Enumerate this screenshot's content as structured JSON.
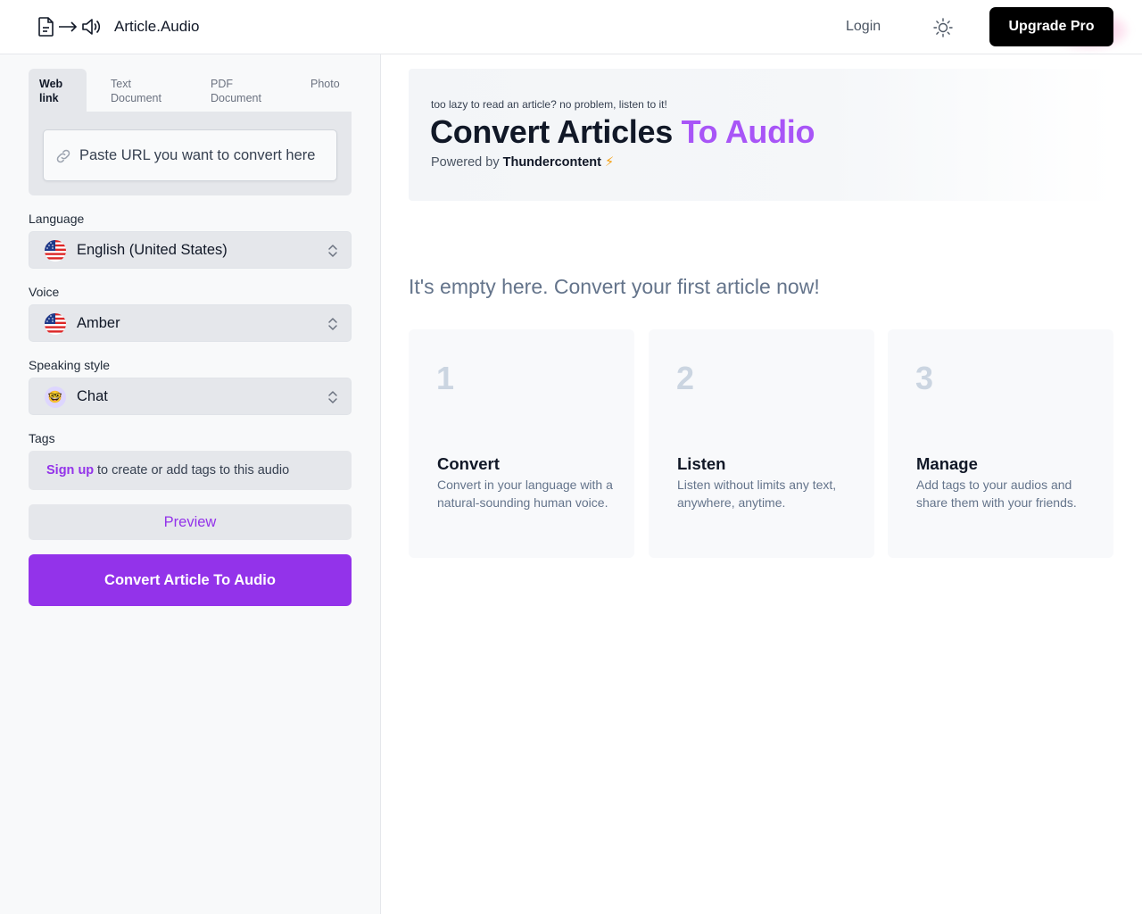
{
  "header": {
    "app_name": "Article.Audio",
    "login_label": "Login",
    "upgrade_label": "Upgrade Pro"
  },
  "sidebar": {
    "tabs": [
      {
        "line1": "Web",
        "line2": "link",
        "active": true
      },
      {
        "line1": "Text",
        "line2": "Document",
        "active": false
      },
      {
        "line1": "PDF",
        "line2": "Document",
        "active": false
      },
      {
        "line1": "Photo",
        "line2": "",
        "active": false
      }
    ],
    "url_placeholder": "Paste URL you want to convert here",
    "language": {
      "label": "Language",
      "value": "English (United States)",
      "icon": "us-flag-icon"
    },
    "voice": {
      "label": "Voice",
      "value": "Amber",
      "icon": "us-flag-icon"
    },
    "speaking_style": {
      "label": "Speaking style",
      "value": "Chat",
      "icon": "nerd-face-icon",
      "emoji": "🤓"
    },
    "tags": {
      "label": "Tags",
      "signup_link": "Sign up",
      "text": "to create or add tags to this audio"
    },
    "preview_label": "Preview",
    "convert_label": "Convert Article To Audio"
  },
  "hero": {
    "tagline": "too lazy to read an article? no problem, listen to it!",
    "title_main": "Convert Articles ",
    "title_accent": "To Audio",
    "powered_prefix": "Powered by ",
    "powered_brand": "Thundercontent",
    "powered_emoji": "⚡"
  },
  "empty_message": "It's empty here. Convert your first article now!",
  "steps": [
    {
      "number": "1",
      "title": "Convert",
      "description": "Convert in your language with a natural-sounding human voice."
    },
    {
      "number": "2",
      "title": "Listen",
      "description": "Listen without limits any text, anywhere, anytime."
    },
    {
      "number": "3",
      "title": "Manage",
      "description": "Add tags to your audios and share them with your friends."
    }
  ],
  "colors": {
    "accent": "#9333ea",
    "accent_light": "#a855f7",
    "button_dark": "#000000"
  }
}
